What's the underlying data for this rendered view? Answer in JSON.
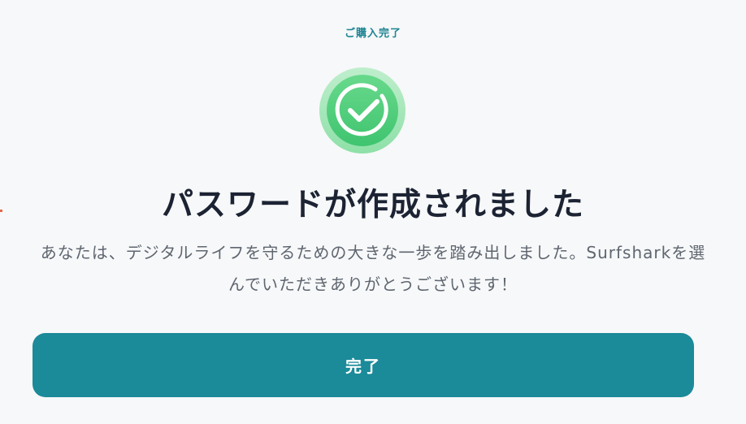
{
  "header": {
    "step_label": "ご購入完了"
  },
  "status": {
    "icon": "check-circle-icon",
    "accent_color": "#4fd07b"
  },
  "content": {
    "title": "パスワードが作成されました",
    "message": "あなたは、デジタルライフを守るための大きな一歩を踏み出しました。Surfsharkを選んでいただきありがとうございます！"
  },
  "actions": {
    "done_label": "完了",
    "button_color": "#1b8a99"
  }
}
